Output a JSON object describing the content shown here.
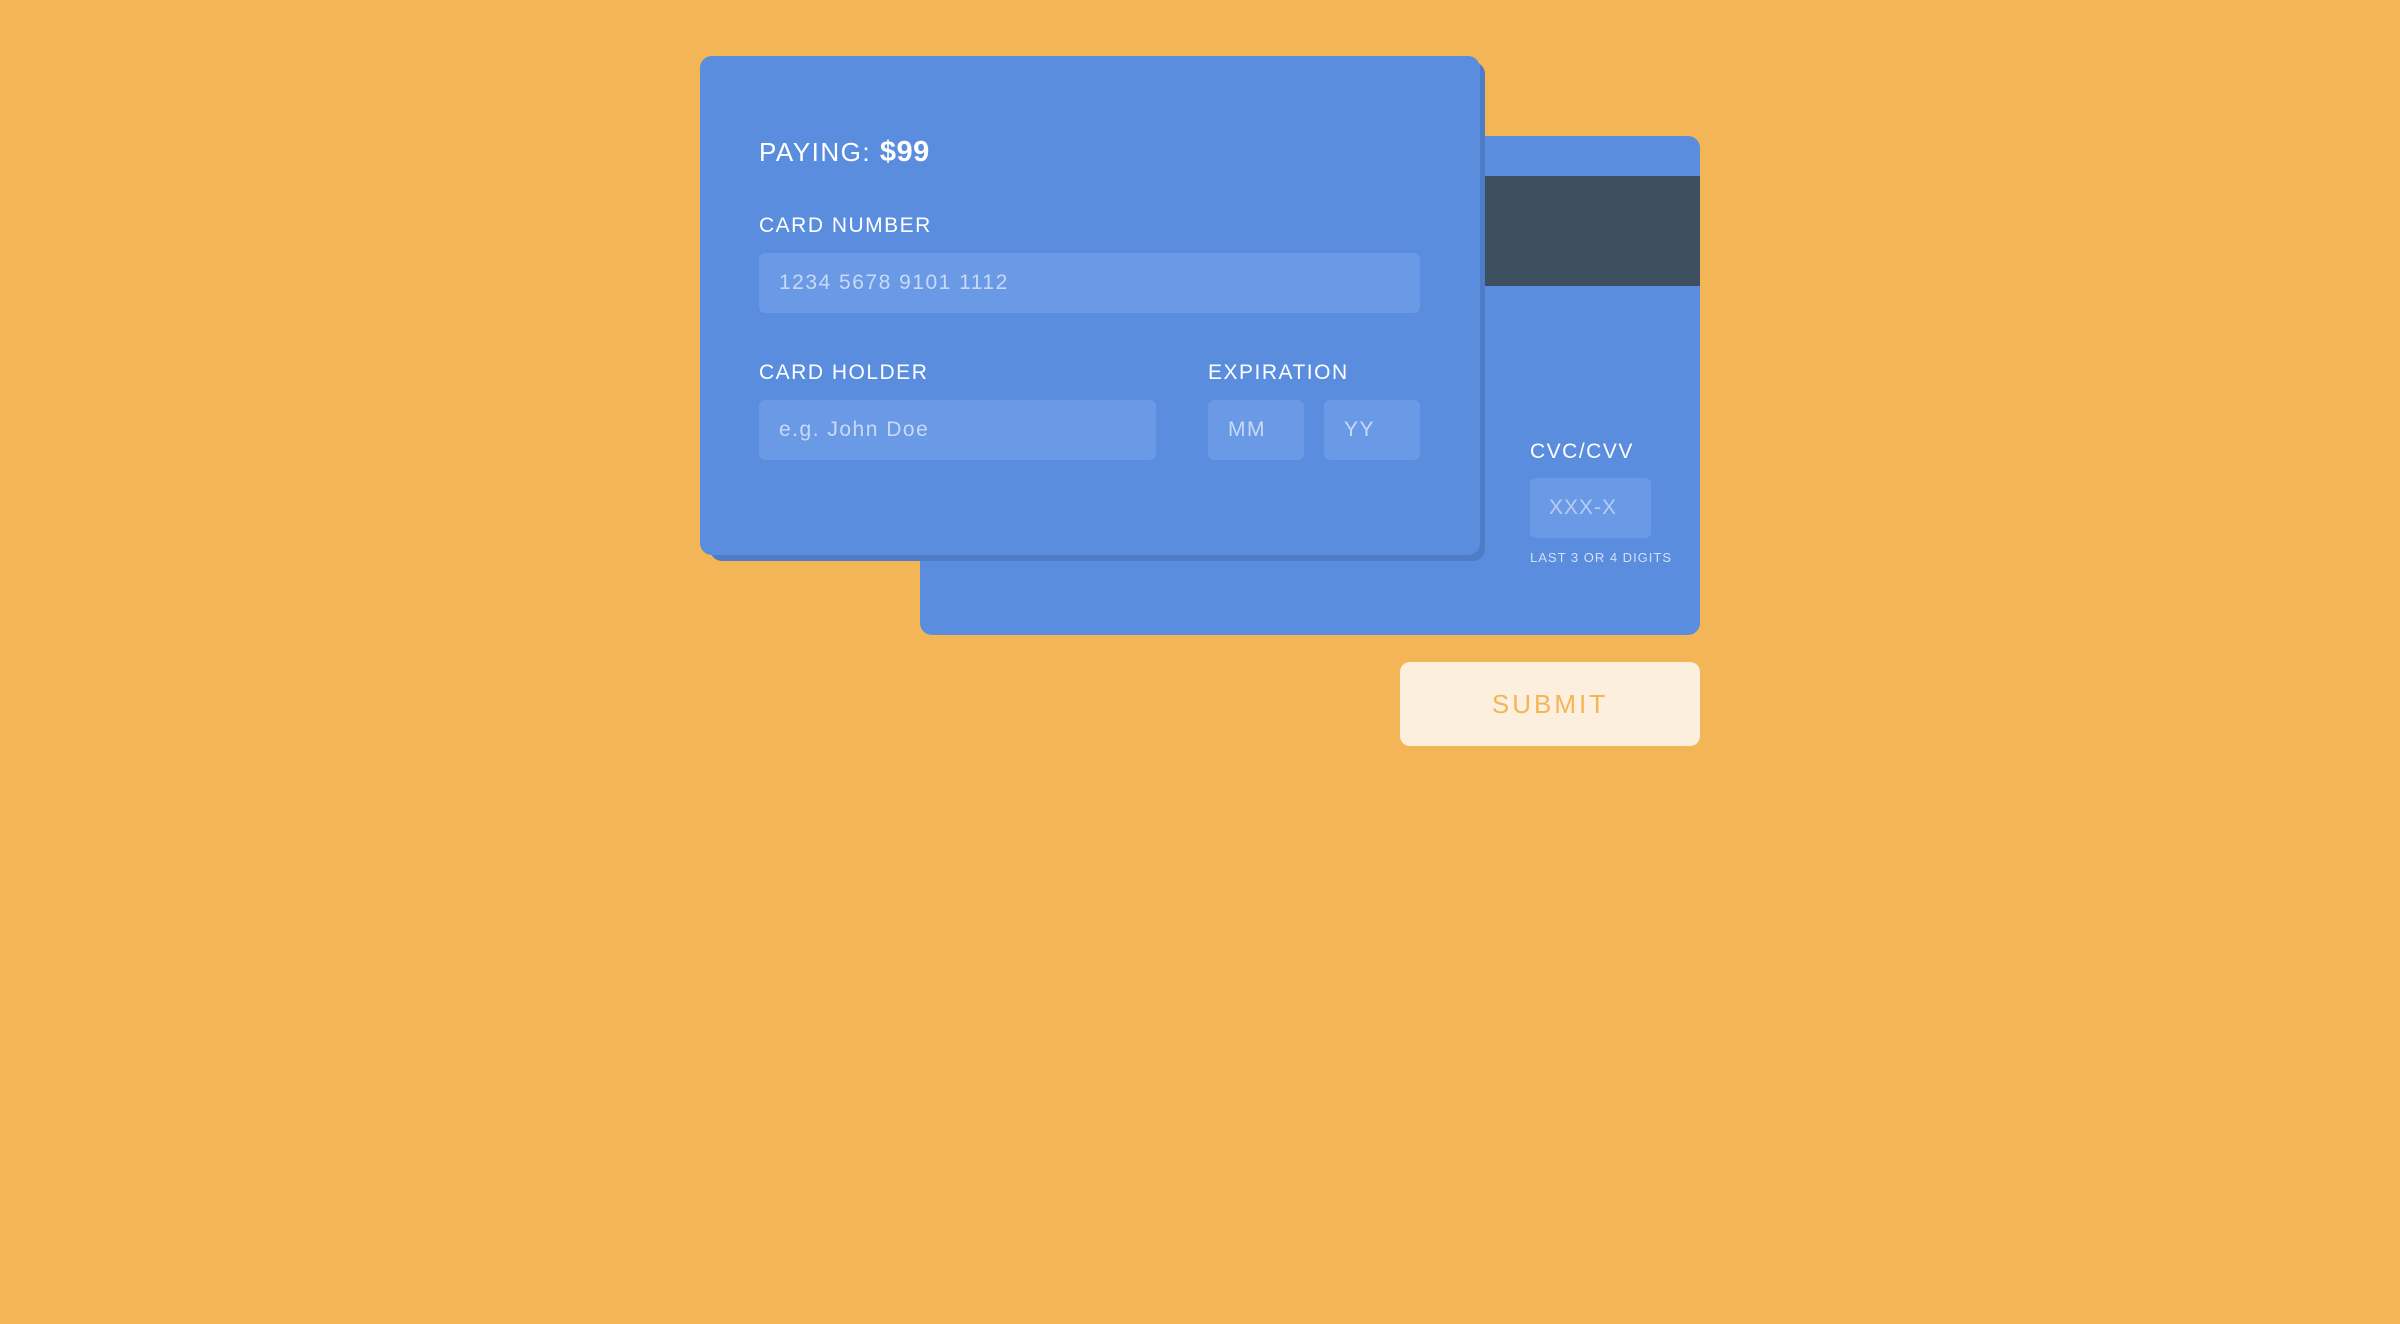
{
  "colors": {
    "background": "#F4B557",
    "card": "#5A8DDE",
    "input": "#6A99E6",
    "magnetic_stripe": "#3E4F62",
    "submit_background": "#FCEFDD",
    "submit_text": "#F4B557"
  },
  "front_card": {
    "paying_label": "PAYING:",
    "paying_amount": "$99",
    "card_number": {
      "label": "CARD NUMBER",
      "placeholder": "1234 5678 9101 1112",
      "value": ""
    },
    "card_holder": {
      "label": "CARD HOLDER",
      "placeholder": "e.g. John Doe",
      "value": ""
    },
    "expiration": {
      "label": "EXPIRATION",
      "month_placeholder": "MM",
      "year_placeholder": "YY"
    }
  },
  "back_card": {
    "cvc": {
      "label": "CVC/CVV",
      "placeholder": "XXX-X",
      "hint": "LAST 3 OR 4 DIGITS"
    }
  },
  "submit": {
    "label": "SUBMIT"
  }
}
